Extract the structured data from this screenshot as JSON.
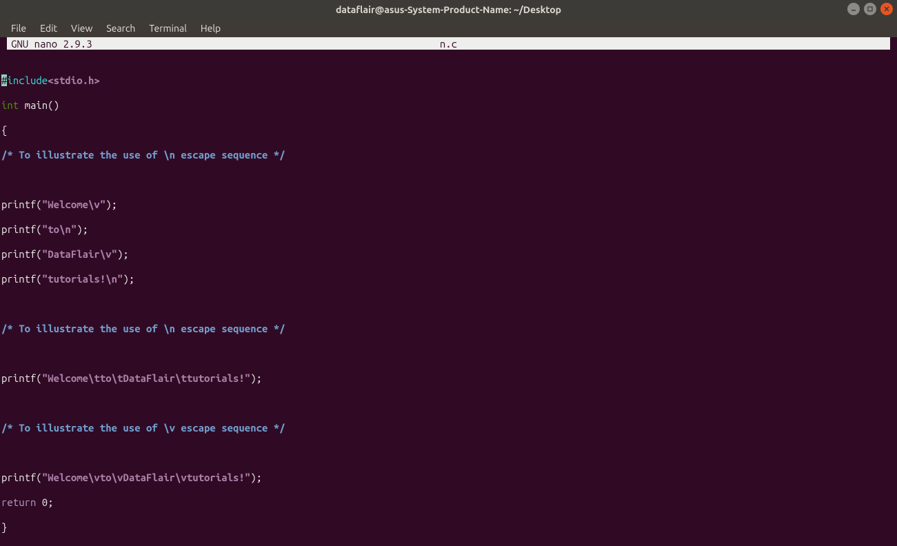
{
  "window": {
    "title": "dataflair@asus-System-Product-Name: ~/Desktop"
  },
  "menu": {
    "file": "File",
    "edit": "Edit",
    "view": "View",
    "search": "Search",
    "terminal": "Terminal",
    "help": "Help"
  },
  "nano": {
    "version_label": "  GNU nano 2.9.3",
    "filename": "n.c"
  },
  "code": {
    "l1a": "#",
    "l1b": "include",
    "l1c": "<stdio.h>",
    "l2a": "int",
    "l2b": " main()",
    "l3": "{",
    "l4": "/* To illustrate the use of \\n escape sequence */",
    "l6a": "printf(",
    "l6b": "\"Welcome\\v\"",
    "l6c": ");",
    "l7a": "printf(",
    "l7b": "\"to\\n\"",
    "l7c": ");",
    "l8a": "printf(",
    "l8b": "\"DataFlair\\v\"",
    "l8c": ");",
    "l9a": "printf(",
    "l9b": "\"tutorials!\\n\"",
    "l9c": ");",
    "l11": "/* To illustrate the use of \\n escape sequence */",
    "l13a": "printf(",
    "l13b": "\"Welcome\\tto\\tDataFlair\\ttutorials!\"",
    "l13c": ");",
    "l15": "/* To illustrate the use of \\v escape sequence */",
    "l17a": "printf(",
    "l17b": "\"Welcome\\vto\\vDataFlair\\vtutorials!\"",
    "l17c": ");",
    "l18a": "return",
    "l18b": " 0;",
    "l19": "}"
  }
}
